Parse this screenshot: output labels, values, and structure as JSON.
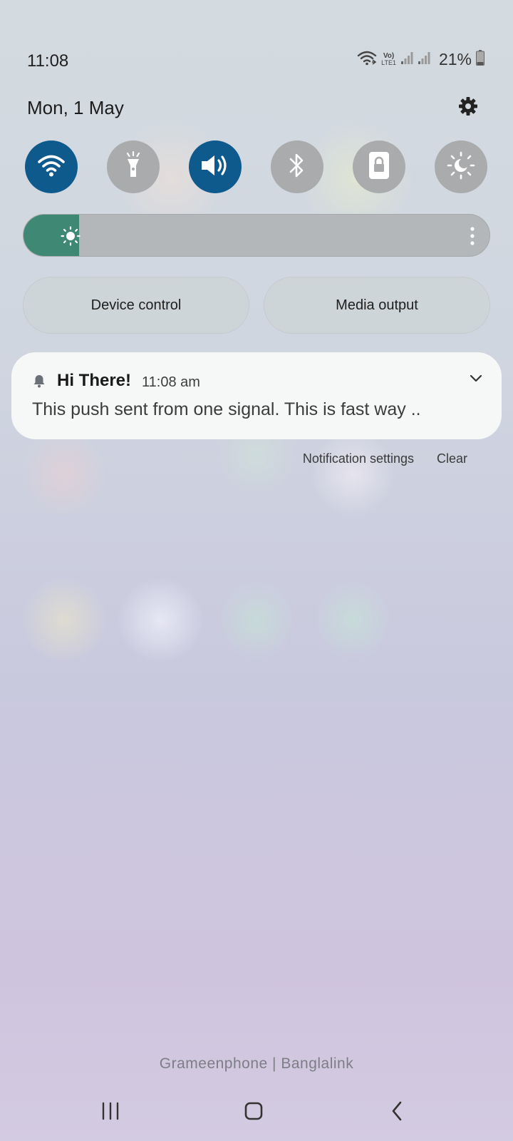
{
  "status_bar": {
    "time": "11:08",
    "volte_label": "Vo)",
    "lte_label": "LTE1",
    "battery_percent": "21%",
    "icons": [
      "wifi-calling-icon",
      "volte-icon",
      "signal-sim1-icon",
      "signal-sim2-icon",
      "battery-icon"
    ]
  },
  "header": {
    "date": "Mon, 1 May",
    "settings_icon": "gear-icon"
  },
  "quick_settings": {
    "tiles": [
      {
        "name": "wifi",
        "icon": "wifi-icon",
        "state": "on"
      },
      {
        "name": "flashlight",
        "icon": "flashlight-icon",
        "state": "off"
      },
      {
        "name": "sound",
        "icon": "volume-icon",
        "state": "on"
      },
      {
        "name": "bluetooth",
        "icon": "bluetooth-icon",
        "state": "off"
      },
      {
        "name": "screen-lock",
        "icon": "lock-icon",
        "state": "off"
      },
      {
        "name": "dark-mode",
        "icon": "brightness-moon-icon",
        "state": "off"
      }
    ],
    "active_color": "#0f5a8c",
    "inactive_color": "#a9abad"
  },
  "brightness": {
    "level": 0.12,
    "fill_color": "#3f8873"
  },
  "buttons": {
    "device_control": "Device control",
    "media_output": "Media output"
  },
  "notification": {
    "title": "Hi There!",
    "time": "11:08 am",
    "body": "This push sent from one signal. This is fast way ..",
    "icon": "bell-icon"
  },
  "notification_actions": {
    "settings_label": "Notification settings",
    "clear_label": "Clear"
  },
  "carrier": "Grameenphone | Banglalink",
  "navigation": {
    "recents_icon": "recents-icon",
    "home_icon": "home-icon",
    "back_icon": "back-icon"
  }
}
